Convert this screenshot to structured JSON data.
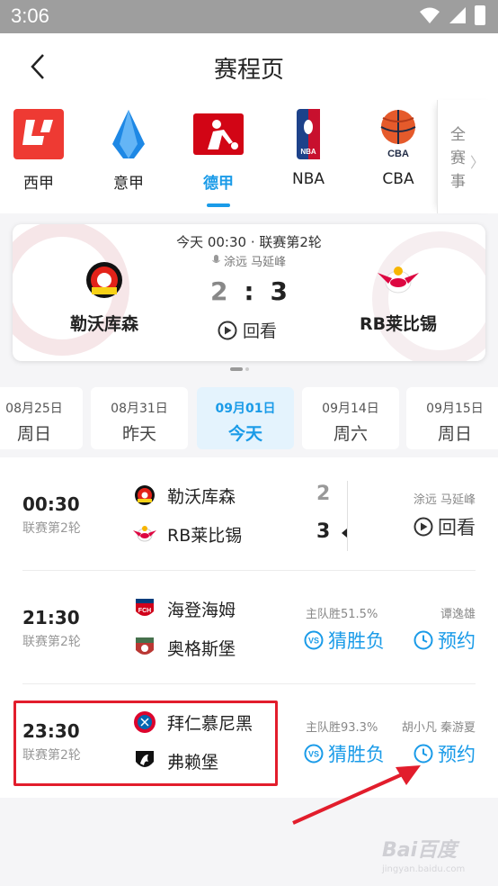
{
  "status_bar": {
    "time": "3:06"
  },
  "header": {
    "title": "赛程页"
  },
  "leagues": [
    {
      "name": "西甲",
      "icon": "laliga-logo-icon",
      "active": false
    },
    {
      "name": "意甲",
      "icon": "serie-a-logo-icon",
      "active": false
    },
    {
      "name": "德甲",
      "icon": "bundesliga-logo-icon",
      "active": true
    },
    {
      "name": "NBA",
      "icon": "nba-logo-icon",
      "active": false
    },
    {
      "name": "CBA",
      "icon": "cba-logo-icon",
      "active": false
    }
  ],
  "more_leagues": {
    "label": "全赛事",
    "chevron": "〉"
  },
  "featured": {
    "time_round": "今天 00:30 · 联赛第2轮",
    "commentators": "涂远 马延峰",
    "home": {
      "name": "勒沃库森",
      "score": "2"
    },
    "away": {
      "name": "RB莱比锡",
      "score": "3"
    },
    "separator": ":",
    "action": "回看"
  },
  "dates": [
    {
      "date": "08月25日",
      "weekday": "周日",
      "active": false
    },
    {
      "date": "08月31日",
      "weekday": "昨天",
      "active": false
    },
    {
      "date": "09月01日",
      "weekday": "今天",
      "active": true
    },
    {
      "date": "09月14日",
      "weekday": "周六",
      "active": false
    },
    {
      "date": "09月15日",
      "weekday": "周日",
      "active": false
    }
  ],
  "matches": [
    {
      "time": "00:30",
      "round": "联赛第2轮",
      "home": {
        "name": "勒沃库森",
        "score": "2"
      },
      "away": {
        "name": "RB莱比锡",
        "score": "3"
      },
      "commentators": "涂远 马延峰",
      "action": "回看"
    },
    {
      "time": "21:30",
      "round": "联赛第2轮",
      "home": {
        "name": "海登海姆"
      },
      "away": {
        "name": "奥格斯堡"
      },
      "odds": "主队胜51.5%",
      "guess": "猜胜负",
      "commentators": "谭逸雄",
      "action": "预约"
    },
    {
      "time": "23:30",
      "round": "联赛第2轮",
      "home": {
        "name": "拜仁慕尼黑"
      },
      "away": {
        "name": "弗赖堡"
      },
      "odds": "主队胜93.3%",
      "guess": "猜胜负",
      "commentators": "胡小凡 秦游夏",
      "action": "预约"
    }
  ],
  "watermark": {
    "text": "Bai百度",
    "sub": "jingyan.baidu.com"
  },
  "colors": {
    "accent": "#1a9be8",
    "highlight": "#e21d2c"
  }
}
